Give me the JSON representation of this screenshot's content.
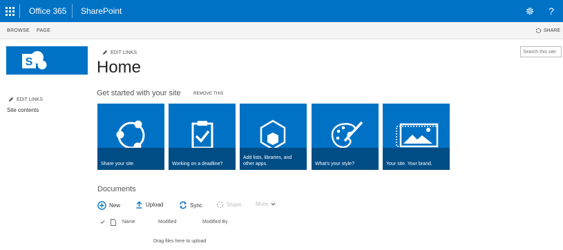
{
  "suitebar": {
    "brand": "Office 365",
    "app": "SharePoint",
    "bg_color": "#0072c6",
    "icons": [
      "app-launcher-icon",
      "gear-icon",
      "help-icon"
    ],
    "help_glyph": "?"
  },
  "ribbon": {
    "tabs": [
      "BROWSE",
      "PAGE"
    ],
    "share_label": "SHARE"
  },
  "search": {
    "placeholder": "Search this site"
  },
  "top_edit_links": "EDIT LINKS",
  "page_title": "Home",
  "left_nav": {
    "edit_links": "EDIT LINKS",
    "items": [
      "Site contents"
    ]
  },
  "get_started": {
    "title": "Get started with your site",
    "remove_label": "REMOVE THIS",
    "tiles": [
      {
        "label": "Share your site.",
        "icon": "share-icon"
      },
      {
        "label": "Working on a deadline?",
        "icon": "clipboard-check-icon"
      },
      {
        "label": "Add lists, libraries, and other apps.",
        "icon": "hexagon-app-icon"
      },
      {
        "label": "What's your style?",
        "icon": "palette-icon"
      },
      {
        "label": "Your site. Your brand.",
        "icon": "picture-icon"
      }
    ],
    "tile_color": "#0072c6",
    "tile_label_bg": "#004d85"
  },
  "documents": {
    "title": "Documents",
    "commands": [
      {
        "label": "New",
        "icon": "plus-circle-icon",
        "enabled": true
      },
      {
        "label": "Upload",
        "icon": "upload-icon",
        "enabled": true
      },
      {
        "label": "Sync",
        "icon": "sync-icon",
        "enabled": true
      },
      {
        "label": "Share",
        "icon": "share-cmd-icon",
        "enabled": false
      },
      {
        "label": "More",
        "icon": "chevron-down-icon",
        "enabled": false
      }
    ],
    "columns": [
      "Name",
      "Modified",
      "Modified By"
    ],
    "drag_hint": "Drag files here to upload"
  }
}
